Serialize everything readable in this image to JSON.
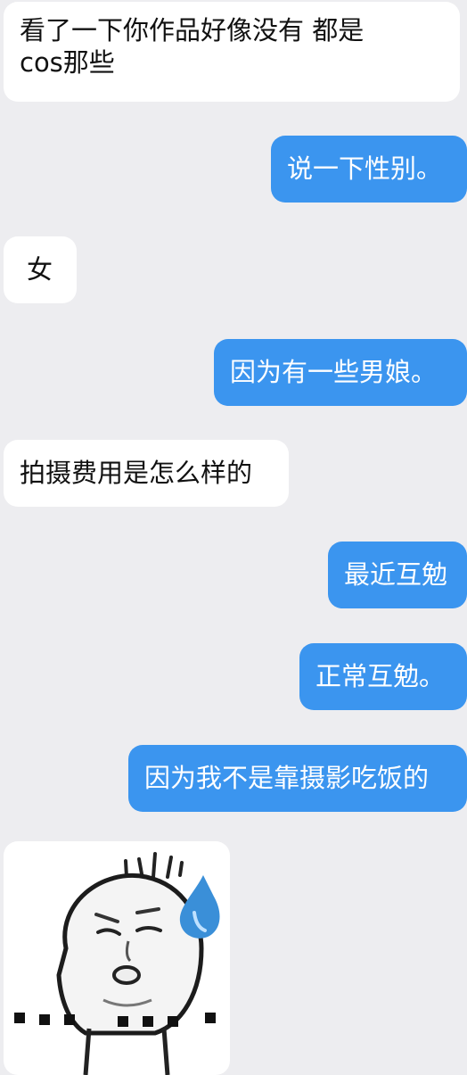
{
  "messages": [
    {
      "side": "in",
      "line1": "看了一下你作品好像没有 都是",
      "line2": "cos那些"
    },
    {
      "side": "out",
      "text": "说一下性别。"
    },
    {
      "side": "in",
      "text": "女"
    },
    {
      "side": "out",
      "text": "因为有一些男娘。"
    },
    {
      "side": "in",
      "text": "拍摄费用是怎么样的"
    },
    {
      "side": "out",
      "text": "最近互勉"
    },
    {
      "side": "out",
      "text": "正常互勉。"
    },
    {
      "side": "out",
      "text": "因为我不是靠摄影吃饭的"
    }
  ],
  "sticker": {
    "icon": "sweating-face-sticker-icon",
    "drop_color": "#3a8fd8"
  },
  "colors": {
    "background": "#ededf0",
    "incoming_bubble": "#ffffff",
    "outgoing_bubble": "#3b95ef"
  }
}
